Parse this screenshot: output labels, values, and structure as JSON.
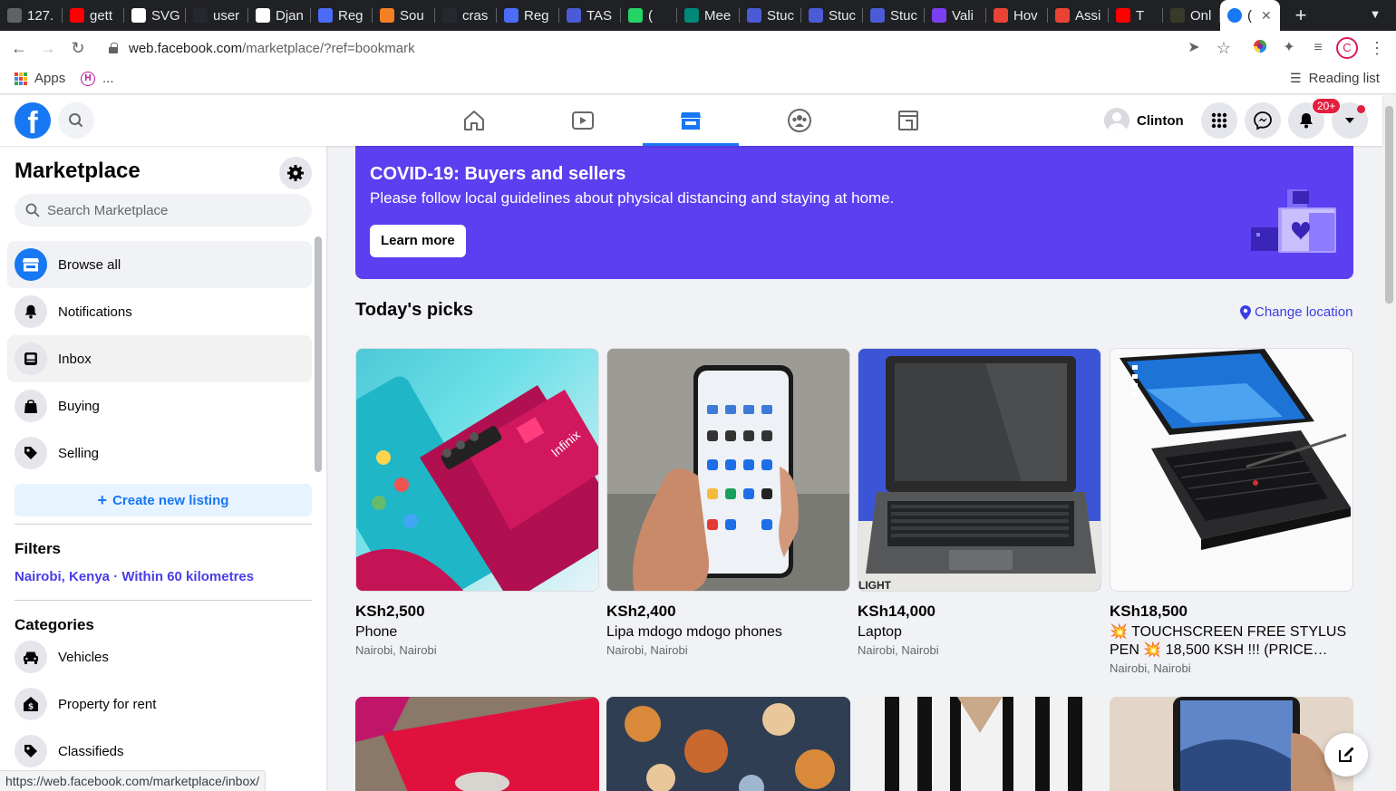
{
  "browser": {
    "tabs": [
      {
        "label": "127.",
        "color": "#5f6368"
      },
      {
        "label": "gett",
        "color": "#ff0000"
      },
      {
        "label": "SVG",
        "color": "#ffffff"
      },
      {
        "label": "user",
        "color": "#24292f"
      },
      {
        "label": "Djan",
        "color": "#ffffff"
      },
      {
        "label": "Reg",
        "color": "#4a6cf7"
      },
      {
        "label": "Sou",
        "color": "#f48024"
      },
      {
        "label": "cras",
        "color": "#24292f"
      },
      {
        "label": "Reg",
        "color": "#4a6cf7"
      },
      {
        "label": "TAS",
        "color": "#4b5bd6"
      },
      {
        "label": "(",
        "color": "#25d366"
      },
      {
        "label": "Mee",
        "color": "#00897b"
      },
      {
        "label": "Stuc",
        "color": "#4b5bd6"
      },
      {
        "label": "Stuc",
        "color": "#4b5bd6"
      },
      {
        "label": "Stuc",
        "color": "#4b5bd6"
      },
      {
        "label": "Vali",
        "color": "#7b3ff2"
      },
      {
        "label": "Hov",
        "color": "#ea4335"
      },
      {
        "label": "Assi",
        "color": "#ea4335"
      },
      {
        "label": "T",
        "color": "#ff0000"
      },
      {
        "label": "Onl",
        "color": "#3a3a2a"
      }
    ],
    "active_tab": {
      "label": "(",
      "color": "#1877f2"
    },
    "url": {
      "domain": "web.facebook.com",
      "path": "/marketplace/?ref=bookmark"
    },
    "bookmarks": {
      "apps": "Apps",
      "h_item": "...",
      "reading_list": "Reading list"
    },
    "profile_initial": "C",
    "status_url": "https://web.facebook.com/marketplace/inbox/"
  },
  "header": {
    "user_name": "Clinton",
    "notification_count": "20+",
    "nav_tabs": [
      "home",
      "watch",
      "marketplace",
      "groups",
      "gaming"
    ],
    "active_nav": "marketplace"
  },
  "sidebar": {
    "title": "Marketplace",
    "search_placeholder": "Search Marketplace",
    "items": [
      {
        "label": "Browse all",
        "icon": "shop-icon"
      },
      {
        "label": "Notifications",
        "icon": "bell-icon"
      },
      {
        "label": "Inbox",
        "icon": "inbox-icon"
      },
      {
        "label": "Buying",
        "icon": "bag-icon"
      },
      {
        "label": "Selling",
        "icon": "tag-icon"
      }
    ],
    "create_listing": "Create new listing",
    "filters_heading": "Filters",
    "filter_location": "Nairobi, Kenya · Within 60 kilometres",
    "categories_heading": "Categories",
    "categories": [
      {
        "label": "Vehicles",
        "icon": "car-icon"
      },
      {
        "label": "Property for rent",
        "icon": "house-dollar-icon"
      },
      {
        "label": "Classifieds",
        "icon": "tag-icon"
      }
    ]
  },
  "banner": {
    "title": "COVID-19: Buyers and sellers",
    "text": "Please follow local guidelines about physical distancing and staying at home.",
    "button": "Learn more",
    "color": "#5c3ff0"
  },
  "main": {
    "section_title": "Today's picks",
    "change_location": "Change location",
    "listings": [
      {
        "price": "KSh2,500",
        "title": "Phone",
        "location": "Nairobi, Nairobi"
      },
      {
        "price": "KSh2,400",
        "title": "Lipa mdogo mdogo phones",
        "location": "Nairobi, Nairobi"
      },
      {
        "price": "KSh14,000",
        "title": "Laptop",
        "location": "Nairobi, Nairobi"
      },
      {
        "price": "KSh18,500",
        "title": "💥 TOUCHSCREEN FREE STYLUS PEN 💥 18,500 KSH !!! (PRICE…",
        "location": "Nairobi, Nairobi"
      }
    ]
  },
  "colors": {
    "accent": "#1877f2",
    "notification": "#e41e3f"
  }
}
